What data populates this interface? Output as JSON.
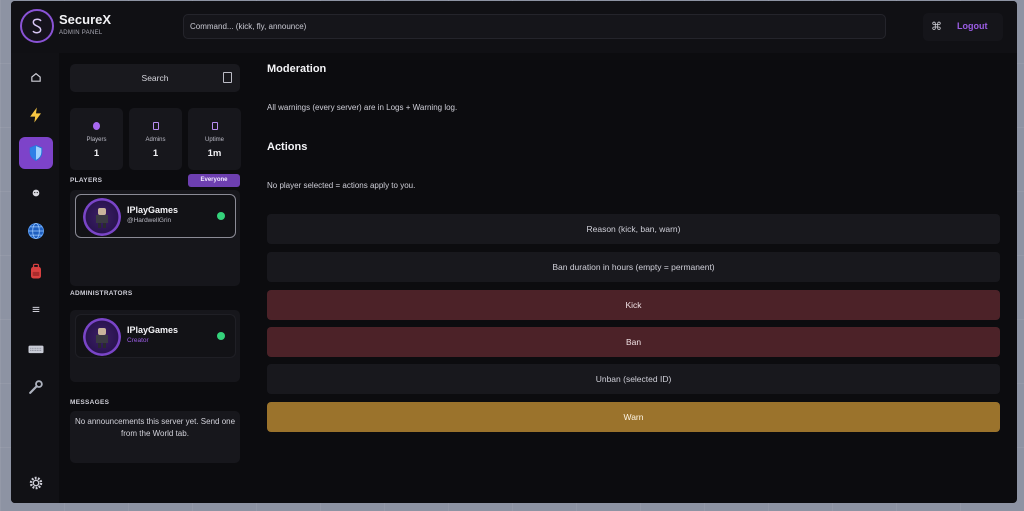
{
  "app": {
    "name": "SecureX",
    "subtitle": "ADMIN PANEL"
  },
  "command_bar": {
    "placeholder": "Command... (kick, fly, announce)"
  },
  "topright": {
    "logout_label": "Logout",
    "icon": "command-icon"
  },
  "rail": {
    "items": [
      {
        "icon": "home-icon",
        "active": false
      },
      {
        "icon": "lightning-icon",
        "active": false
      },
      {
        "icon": "shield-icon",
        "active": true
      },
      {
        "icon": "face-icon",
        "active": false
      },
      {
        "icon": "globe-icon",
        "active": false
      },
      {
        "icon": "backpack-icon",
        "active": false
      },
      {
        "icon": "list-icon",
        "active": false
      },
      {
        "icon": "keyboard-icon",
        "active": false
      },
      {
        "icon": "wrench-icon",
        "active": false
      },
      {
        "icon": "gear-icon",
        "active": false
      }
    ]
  },
  "search": {
    "label": "Search"
  },
  "stats": [
    {
      "label": "Players",
      "value": "1",
      "icon": "dot-icon"
    },
    {
      "label": "Admins",
      "value": "1",
      "icon": "tablet-icon"
    },
    {
      "label": "Uptime",
      "value": "1m",
      "icon": "tablet-icon"
    }
  ],
  "players": {
    "title": "PLAYERS",
    "filter": "Everyone",
    "list": [
      {
        "name": "IPlayGames",
        "handle": "@HardwellGrin",
        "online": true
      }
    ]
  },
  "administrators": {
    "title": "ADMINISTRATORS",
    "list": [
      {
        "name": "IPlayGames",
        "role": "Creator",
        "online": true
      }
    ]
  },
  "messages": {
    "title": "MESSAGES",
    "text": "No announcements this server yet. Send one from the World tab."
  },
  "main": {
    "moderation_title": "Moderation",
    "moderation_note": "All warnings (every server) are in Logs + Warning log.",
    "actions_title": "Actions",
    "actions_note": "No player selected = actions apply to you.",
    "reason_placeholder": "Reason (kick, ban, warn)",
    "duration_placeholder": "Ban duration in hours (empty = permanent)",
    "kick_label": "Kick",
    "ban_label": "Ban",
    "unban_label": "Unban (selected ID)",
    "warn_label": "Warn"
  },
  "colors": {
    "accent": "#7d43c9",
    "danger": "#4c2228",
    "warn": "#9b732c",
    "online": "#34d27b"
  }
}
